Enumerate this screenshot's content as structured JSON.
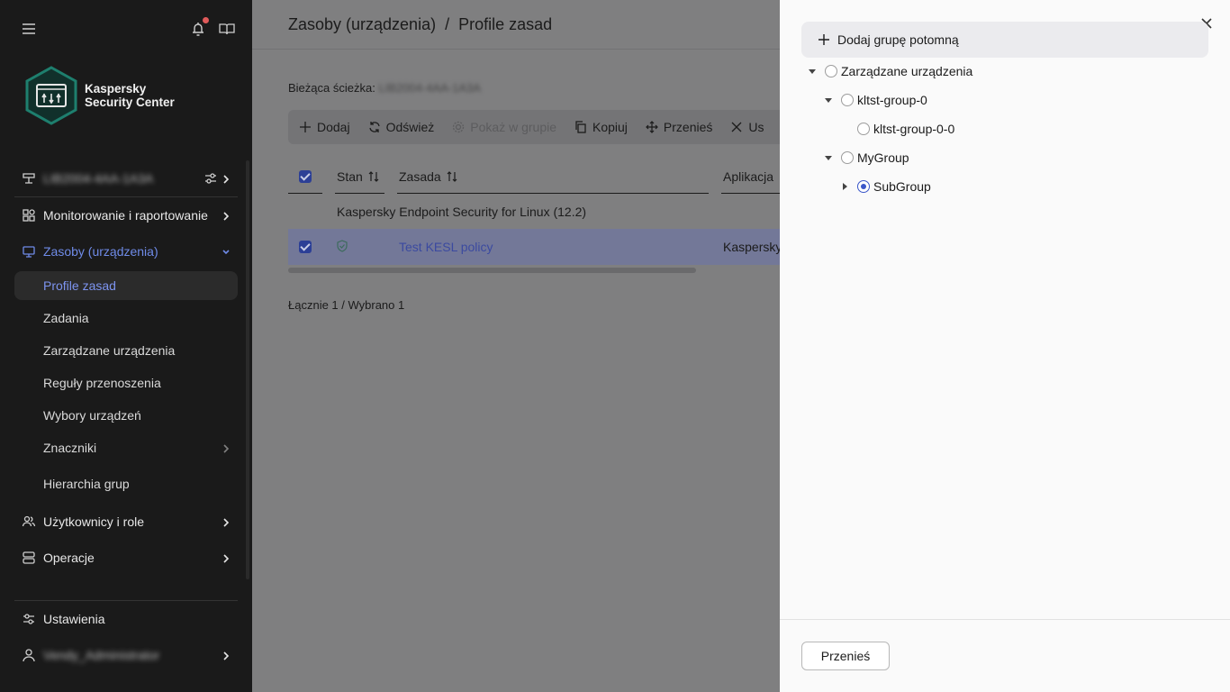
{
  "sidebar": {
    "logo": {
      "line1": "Kaspersky",
      "line2": "Security Center"
    },
    "server_name": "LIB2004-4AA-1A3A",
    "nav": [
      {
        "label": "Monitorowanie i raportowanie"
      },
      {
        "label": "Zasoby (urządzenia)"
      }
    ],
    "sub_items": [
      {
        "label": "Profile zasad"
      },
      {
        "label": "Zadania"
      },
      {
        "label": "Zarządzane urządzenia"
      },
      {
        "label": "Reguły przenoszenia"
      },
      {
        "label": "Wybory urządzeń"
      },
      {
        "label": "Znaczniki"
      },
      {
        "label": "Hierarchia grup"
      }
    ],
    "nav2": [
      {
        "label": "Użytkownicy i role"
      },
      {
        "label": "Operacje"
      }
    ],
    "settings_label": "Ustawienia",
    "user_name": "Vendy_Administrator"
  },
  "main": {
    "title": "Zasoby (urządzenia)  /  Profile zasad",
    "path_label": "Bieżąca ścieżka:",
    "path_value": "LIB2004-4AA-1A3A",
    "toolbar": {
      "add": "Dodaj",
      "refresh": "Odśwież",
      "show_in_group": "Pokaż w grupie",
      "copy": "Kopiuj",
      "move": "Przenieś",
      "delete": "Us"
    },
    "table": {
      "col_status": "Stan",
      "col_policy": "Zasada",
      "col_app": "Aplikacja",
      "group_label": "Kaspersky Endpoint Security for Linux (12.2)",
      "row_name": "Test KESL policy",
      "row_app": "Kaspersky"
    },
    "totals": "Łącznie 1 / Wybrano 1"
  },
  "panel": {
    "add_child_label": "Dodaj grupę potomną",
    "tree": [
      {
        "label": "Zarządzane urządzenia"
      },
      {
        "label": "kltst-group-0"
      },
      {
        "label": "kltst-group-0-0"
      },
      {
        "label": "MyGroup"
      },
      {
        "label": "SubGroup"
      }
    ],
    "move_button": "Przenieś"
  },
  "colors": {
    "accent": "#3a56c9",
    "sidebar_bg": "#1a1a1a",
    "active_nav": "#6f8be8",
    "logo_green": "#1e7f6e"
  }
}
